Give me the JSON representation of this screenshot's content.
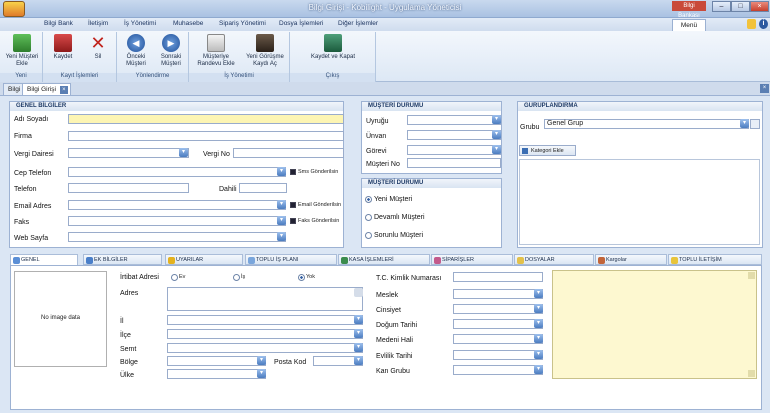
{
  "titlebar": {
    "title": "Bilgi Girişi - Kobilight - Uygulama Yöneticisi",
    "badge": "Bilgi Bankası"
  },
  "menubar": {
    "items": [
      "Bilgi Bank",
      "İletişim",
      "İş Yönetimi",
      "Muhasebe",
      "Sipariş Yönetimi",
      "Dosya İşlemleri",
      "Diğer İşlemler"
    ],
    "menu_tab": "Menü"
  },
  "ribbon": {
    "groups": [
      {
        "label": "Yeni",
        "buttons": [
          "Yeni Müşteri Ekle"
        ]
      },
      {
        "label": "Kayıt İşlemleri",
        "buttons": [
          "Kaydet",
          "Sil"
        ]
      },
      {
        "label": "Yönlendirme",
        "buttons": [
          "Önceki Müşteri",
          "Sonraki Müşteri"
        ]
      },
      {
        "label": "İş Yönetimi",
        "buttons": [
          "Müşteriye Randevu Ekle",
          "Yeni Görüşme Kaydı Aç"
        ]
      },
      {
        "label": "Çıkış",
        "buttons": [
          "Kaydet ve Kapat"
        ]
      }
    ]
  },
  "doctabs": [
    "Bilgi",
    "Bilgi Girişi"
  ],
  "genel": {
    "header": "GENEL BİLGİLER",
    "labels": {
      "ad": "Adı Soyadı",
      "firma": "Firma",
      "vergi_dairesi": "Vergi Dairesi",
      "vergi_no": "Vergi No",
      "cep": "Cep Telefon",
      "telefon": "Telefon",
      "dahili": "Dahili",
      "email": "Email Adres",
      "faks": "Faks",
      "web": "Web Sayfa"
    },
    "options": {
      "sms": "Sms Gönderilsin",
      "email": "Email Gönderilsin",
      "faks": "Faks Gönderilsin"
    }
  },
  "durum1": {
    "header": "MÜŞTERİ DURUMU",
    "labels": [
      "Uyruğu",
      "Ünvan",
      "Görevi",
      "Müşteri No"
    ]
  },
  "durum2": {
    "header": "MÜŞTERİ DURUMU",
    "options": [
      "Yeni Müşteri",
      "Devamlı Müşteri",
      "Sorunlu Müşteri"
    ],
    "selected": 0
  },
  "grup": {
    "header": "GURUPLANDIRMA",
    "label": "Grubu",
    "value": "Genel Grup",
    "add_button": "Kategori Ekle"
  },
  "bottom_tabs": [
    "GENEL",
    "EK BİLGİLER",
    "UYARILAR",
    "TOPLU İŞ PLANI",
    "KASA İŞLEMLERİ",
    "SİPARİŞLER",
    "DOSYALAR",
    "Kargolar",
    "TOPLU İLETİŞİM"
  ],
  "genel_tab": {
    "no_image": "No image data",
    "irtibat_label": "İrtibat Adresi",
    "irtibat_options": [
      "Ev",
      "İş",
      "Yok"
    ],
    "irtibat_selected": 2,
    "labels": {
      "adres": "Adres",
      "il": "İl",
      "ilce": "İlçe",
      "semt": "Semt",
      "bolge": "Bölge",
      "posta_kod": "Posta Kod",
      "ulke": "Ülke"
    },
    "right_labels": [
      "T.C. Kimlik Numarası",
      "Meslek",
      "Cinsiyet",
      "Doğum Tarihi",
      "Medeni Hali",
      "Evlilik Tarihi",
      "Kan Grubu"
    ]
  },
  "colors": {
    "accent": "#2d5aa0",
    "highlight": "#fdf5b3",
    "note": "#fdf8d0"
  }
}
